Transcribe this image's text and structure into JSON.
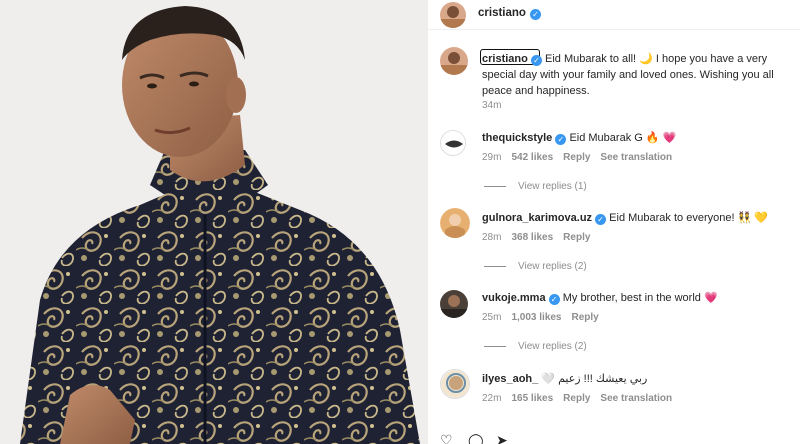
{
  "post": {
    "username": "cristiano",
    "caption": "Eid Mubarak to all! 🌙 I hope you have a very special day with your family and loved ones. Wishing you all peace and happiness.",
    "time": "34m"
  },
  "comments": [
    {
      "username": "thequickstyle",
      "text": "Eid Mubarak G 🔥 💗",
      "time": "29m",
      "likes": "542 likes",
      "reply": "Reply",
      "translate": "See translation",
      "replies": "View replies (1)"
    },
    {
      "username": "gulnora_karimova.uz",
      "text": "Eid Mubarak to everyone! 👯 💛",
      "time": "28m",
      "likes": "368 likes",
      "reply": "Reply",
      "replies": "View replies (2)"
    },
    {
      "username": "vukoje.mma",
      "text": "My brother, best in the world 💗",
      "time": "25m",
      "likes": "1,003 likes",
      "reply": "Reply",
      "replies": "View replies (2)"
    },
    {
      "username": "ilyes_aoh_",
      "text": "🤍 ربي يعيشك !!! زعيم",
      "time": "22m",
      "likes": "165 likes",
      "reply": "Reply",
      "translate": "See translation"
    }
  ],
  "colors": {
    "verified": "#3897f0",
    "meta": "#8e8e8e",
    "text": "#262626",
    "robe_dark": "#1f2233",
    "robe_gold": "#b8a47a"
  },
  "icons": [
    "verified-badge-icon",
    "heart-icon",
    "comment-icon",
    "share-icon"
  ]
}
